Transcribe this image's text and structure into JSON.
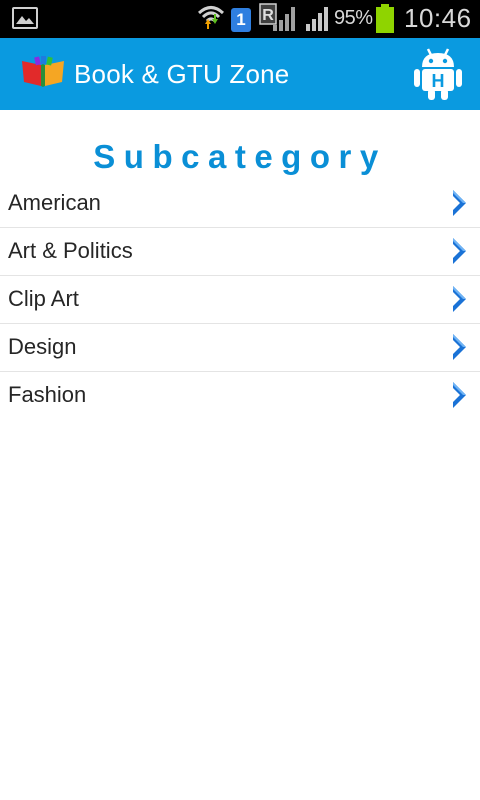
{
  "status_bar": {
    "icons": [
      "gallery-icon",
      "wifi-icon",
      "sim-icon",
      "roaming-signal-icon",
      "signal-icon",
      "battery-icon"
    ],
    "sim_label": "1",
    "roaming_label": "R",
    "battery_percent": "95%",
    "time": "10:46"
  },
  "action_bar": {
    "title": "Book & GTU Zone",
    "logo_icon": "books-icon",
    "action_icon": "android-icon",
    "action_letter": "H",
    "color": "#0a9ae0"
  },
  "main": {
    "heading": "Subcategory",
    "items": [
      {
        "label": "American"
      },
      {
        "label": "Art & Politics"
      },
      {
        "label": "Clip Art"
      },
      {
        "label": "Design"
      },
      {
        "label": "Fashion"
      }
    ],
    "chevron_icon": "chevron-right-icon",
    "accent": "#0a8fd6"
  }
}
